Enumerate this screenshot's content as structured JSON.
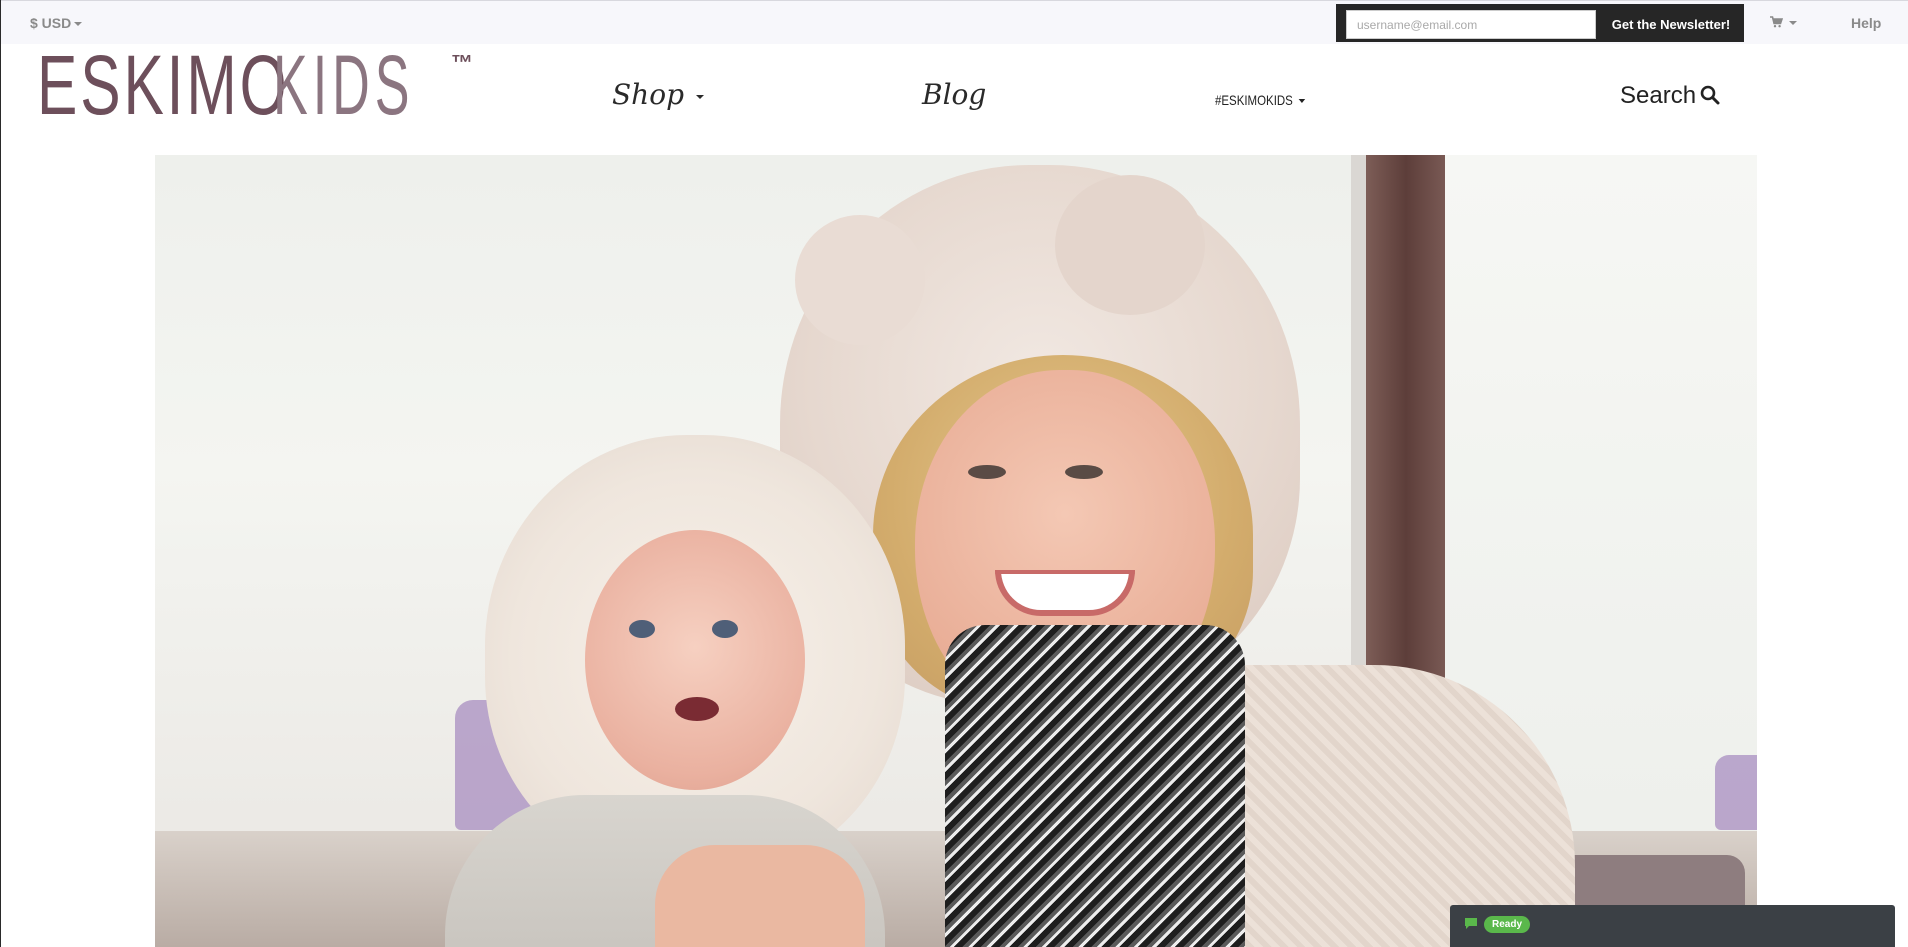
{
  "topbar": {
    "currency_label": "$ USD",
    "newsletter": {
      "email_placeholder": "username@email.com",
      "submit_label": "Get the Newsletter!"
    },
    "help_label": "Help"
  },
  "header": {
    "logo": {
      "word1": "ESKIMO",
      "word2": "KIDS",
      "trademark": "™"
    },
    "nav": {
      "shop_label": "Shop",
      "blog_label": "Blog",
      "hashtag_label": "#ESKIMOKIDS",
      "search_label": "Search"
    }
  },
  "status_widget": {
    "badge": "Ready"
  },
  "icons": [
    "chevron-down-icon",
    "cart-icon",
    "search-icon",
    "chat-icon"
  ],
  "colors": {
    "logo": "#6d4f5b",
    "newsletter_bg": "#262626",
    "status_bg": "#3b4045",
    "badge": "#5ab84b"
  }
}
